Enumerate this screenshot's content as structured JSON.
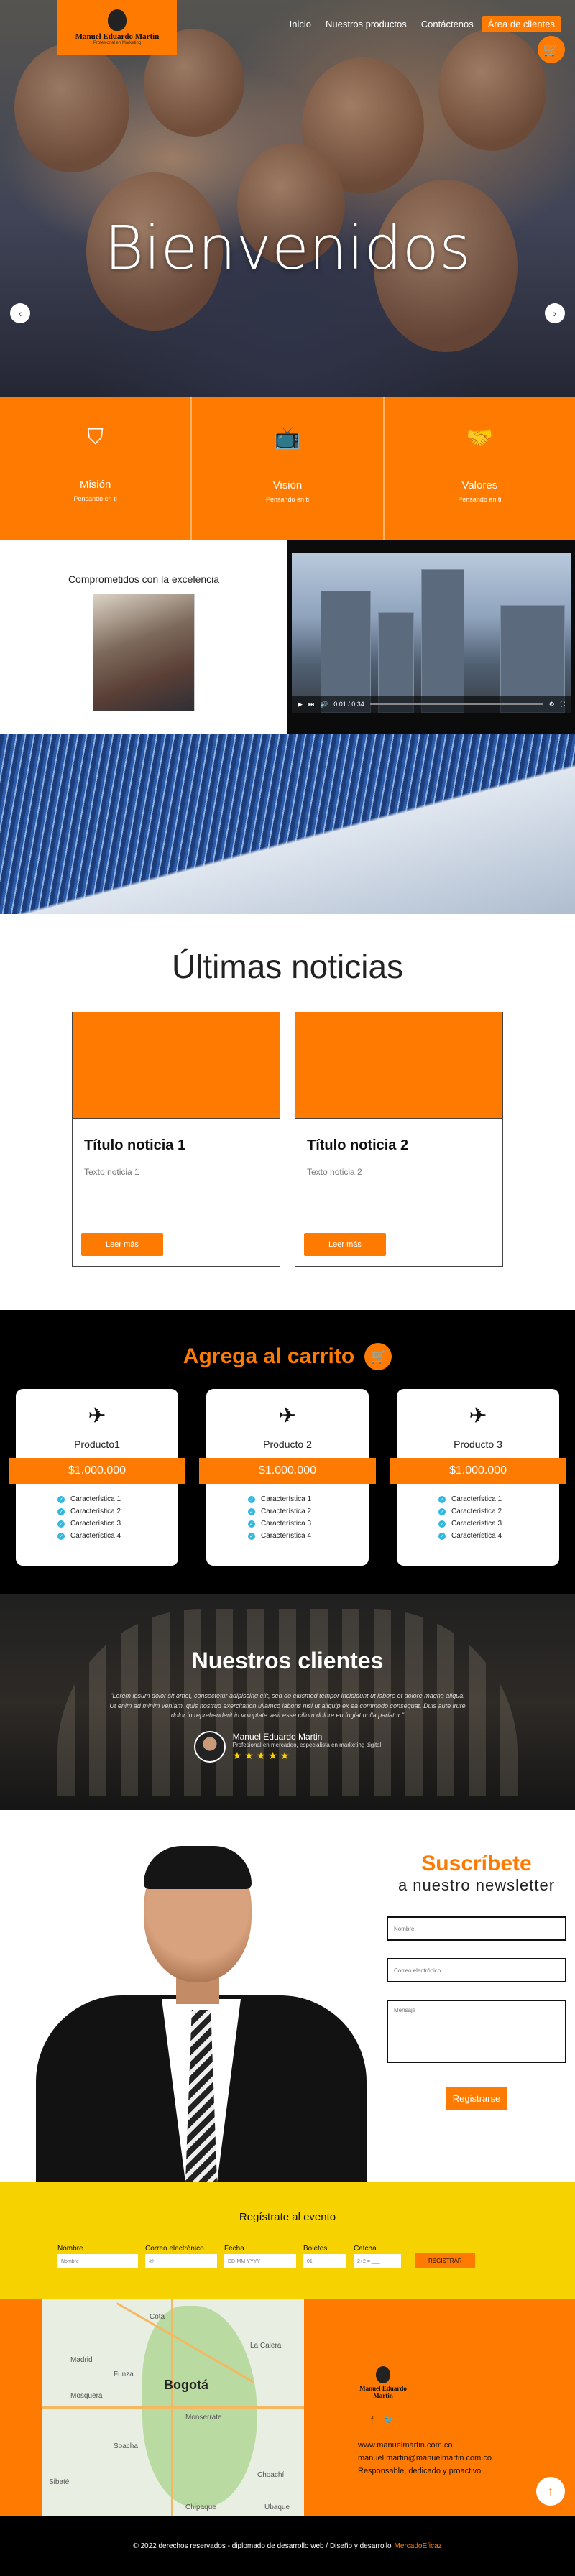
{
  "brand": {
    "name": "Manuel Eduardo Martin",
    "tagline": "Profesional en Marketing"
  },
  "nav": [
    {
      "label": "Inicio"
    },
    {
      "label": "Nuestros productos"
    },
    {
      "label": "Contáctenos"
    },
    {
      "label": "Área de clientes"
    }
  ],
  "hero": {
    "title": "Bienvenidos",
    "prev": "‹",
    "next": "›"
  },
  "mvv": [
    {
      "title": "Misión",
      "subtitle": "Pensando en ti"
    },
    {
      "title": "Visión",
      "subtitle": "Pensando en ti"
    },
    {
      "title": "Valores",
      "subtitle": "Pensando en ti"
    }
  ],
  "commitment": {
    "title": "Comprometidos con la excelencia"
  },
  "video": {
    "time": "0:01 / 0:34"
  },
  "news": {
    "heading": "Últimas noticias",
    "items": [
      {
        "title": "Título noticia 1",
        "text": "Texto noticia 1",
        "button": "Leer más"
      },
      {
        "title": "Título noticia 2",
        "text": "Texto noticia 2",
        "button": "Leer más"
      }
    ]
  },
  "cart": {
    "heading": "Agrega al carrito",
    "products": [
      {
        "name": "Producto1",
        "price": "$1.000.000",
        "features": [
          "Característica 1",
          "Característica 2",
          "Característica 3",
          "Característica 4"
        ]
      },
      {
        "name": "Producto 2",
        "price": "$1.000.000",
        "features": [
          "Característica 1",
          "Característica 2",
          "Característica 3",
          "Característica 4"
        ]
      },
      {
        "name": "Producto 3",
        "price": "$1.000.000",
        "features": [
          "Característica 1",
          "Característica 2",
          "Característica 3",
          "Característica 4"
        ]
      }
    ]
  },
  "clients": {
    "heading": "Nuestros clientes",
    "quote": "\"Lorem ipsum dolor sit amet, consectetur adipiscing elit, sed do eiusmod tempor incididunt ut labore et dolore magna aliqua. Ut enim ad minim veniam, quis nostrud exercitation ullamco laboris nisi ut aliquip ex ea commodo consequat. Duis aute irure dolor in reprehenderit in voluptate velit esse cillum dolore eu fugiat nulla pariatur.\"",
    "person_name": "Manuel Eduardo Martin",
    "person_role": "Profesional en mercadeo, especialista en marketing digital",
    "stars": "★★★★★"
  },
  "newsletter": {
    "title": "Suscríbete",
    "subtitle": "a nuestro newsletter",
    "name_placeholder": "Nombre",
    "email_placeholder": "Correo electrónico",
    "message_placeholder": "Mensaje",
    "button": "Registrarse"
  },
  "event": {
    "title": "Regístrate al evento",
    "fields": [
      {
        "label": "Nombre",
        "placeholder": "Nombre"
      },
      {
        "label": "Correo electrónico",
        "placeholder": "@"
      },
      {
        "label": "Fecha",
        "placeholder": "DD-MM-YYYY"
      },
      {
        "label": "Boletos",
        "placeholder": "01"
      },
      {
        "label": "Catcha",
        "placeholder": "2+2 = ___"
      }
    ],
    "button": "REGISTRAR"
  },
  "map": {
    "city": "Bogotá",
    "labels": [
      "Cota",
      "Madrid",
      "Funza",
      "Mosquera",
      "Soacha",
      "Sibaté",
      "Chipaque",
      "Choachí",
      "Monserrate",
      "Ubaque",
      "La Calera"
    ]
  },
  "footer_info": {
    "web": "www.manuelmartin.com.co",
    "email": "manuel.martin@manuelmartin.com.co",
    "slogan": "Responsable, dedicado y proactivo"
  },
  "copyright": {
    "text": "© 2022 derechos reservados - diplomado de desarrollo web / Diseño y desarrollo",
    "highlight": "MercadoEficaz"
  },
  "colors": {
    "accent": "#ff7a00",
    "event_bg": "#f5d200",
    "dark": "#000000"
  }
}
